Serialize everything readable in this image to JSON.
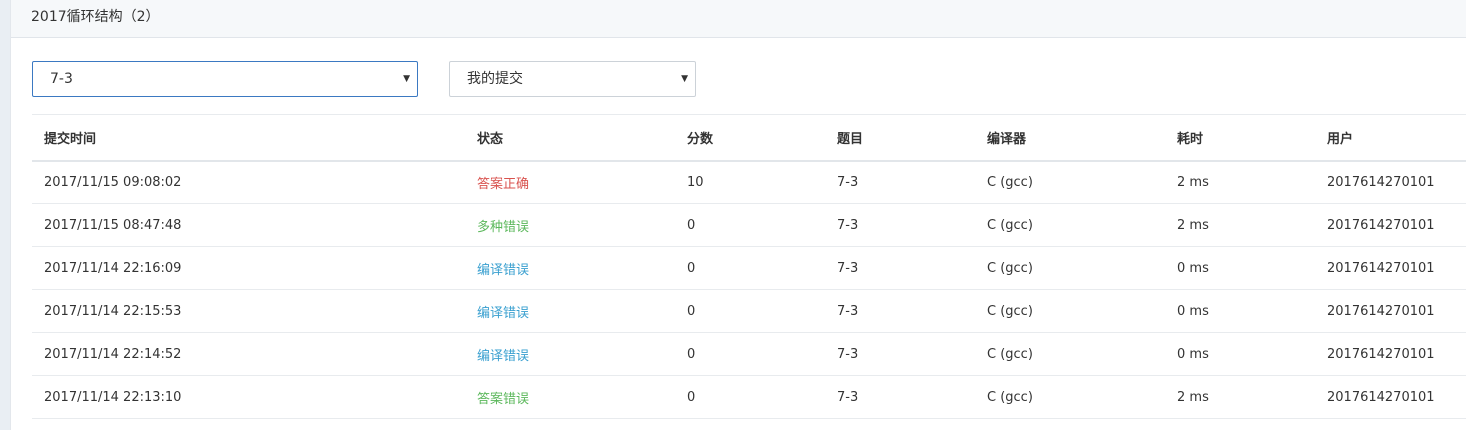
{
  "header": {
    "title": "2017循环结构（2）"
  },
  "filters": {
    "problem_select": {
      "value": "7-3",
      "caret": "▼"
    },
    "scope_select": {
      "value": "我的提交",
      "caret": "▼"
    }
  },
  "table": {
    "columns": [
      "提交时间",
      "状态",
      "分数",
      "题目",
      "编译器",
      "耗时",
      "用户"
    ],
    "rows": [
      {
        "time": "2017/11/15 09:08:02",
        "status": "答案正确",
        "score": "10",
        "problem": "7-3",
        "compiler": "C (gcc)",
        "cost": "2 ms",
        "user": "2017614270101",
        "status_kind": "accept"
      },
      {
        "time": "2017/11/15 08:47:48",
        "status": "多种错误",
        "score": "0",
        "problem": "7-3",
        "compiler": "C (gcc)",
        "cost": "2 ms",
        "user": "2017614270101",
        "status_kind": "wrong"
      },
      {
        "time": "2017/11/14 22:16:09",
        "status": "编译错误",
        "score": "0",
        "problem": "7-3",
        "compiler": "C (gcc)",
        "cost": "0 ms",
        "user": "2017614270101",
        "status_kind": "compile"
      },
      {
        "time": "2017/11/14 22:15:53",
        "status": "编译错误",
        "score": "0",
        "problem": "7-3",
        "compiler": "C (gcc)",
        "cost": "0 ms",
        "user": "2017614270101",
        "status_kind": "compile"
      },
      {
        "time": "2017/11/14 22:14:52",
        "status": "编译错误",
        "score": "0",
        "problem": "7-3",
        "compiler": "C (gcc)",
        "cost": "0 ms",
        "user": "2017614270101",
        "status_kind": "compile"
      },
      {
        "time": "2017/11/14 22:13:10",
        "status": "答案错误",
        "score": "0",
        "problem": "7-3",
        "compiler": "C (gcc)",
        "cost": "2 ms",
        "user": "2017614270101",
        "status_kind": "wrong"
      }
    ]
  },
  "colors": {
    "accept": "#d9534f",
    "wrong": "#5cb85c",
    "compile": "#3aa0d0",
    "link": "#2b5aa0",
    "focus_border": "#3b79c2"
  }
}
